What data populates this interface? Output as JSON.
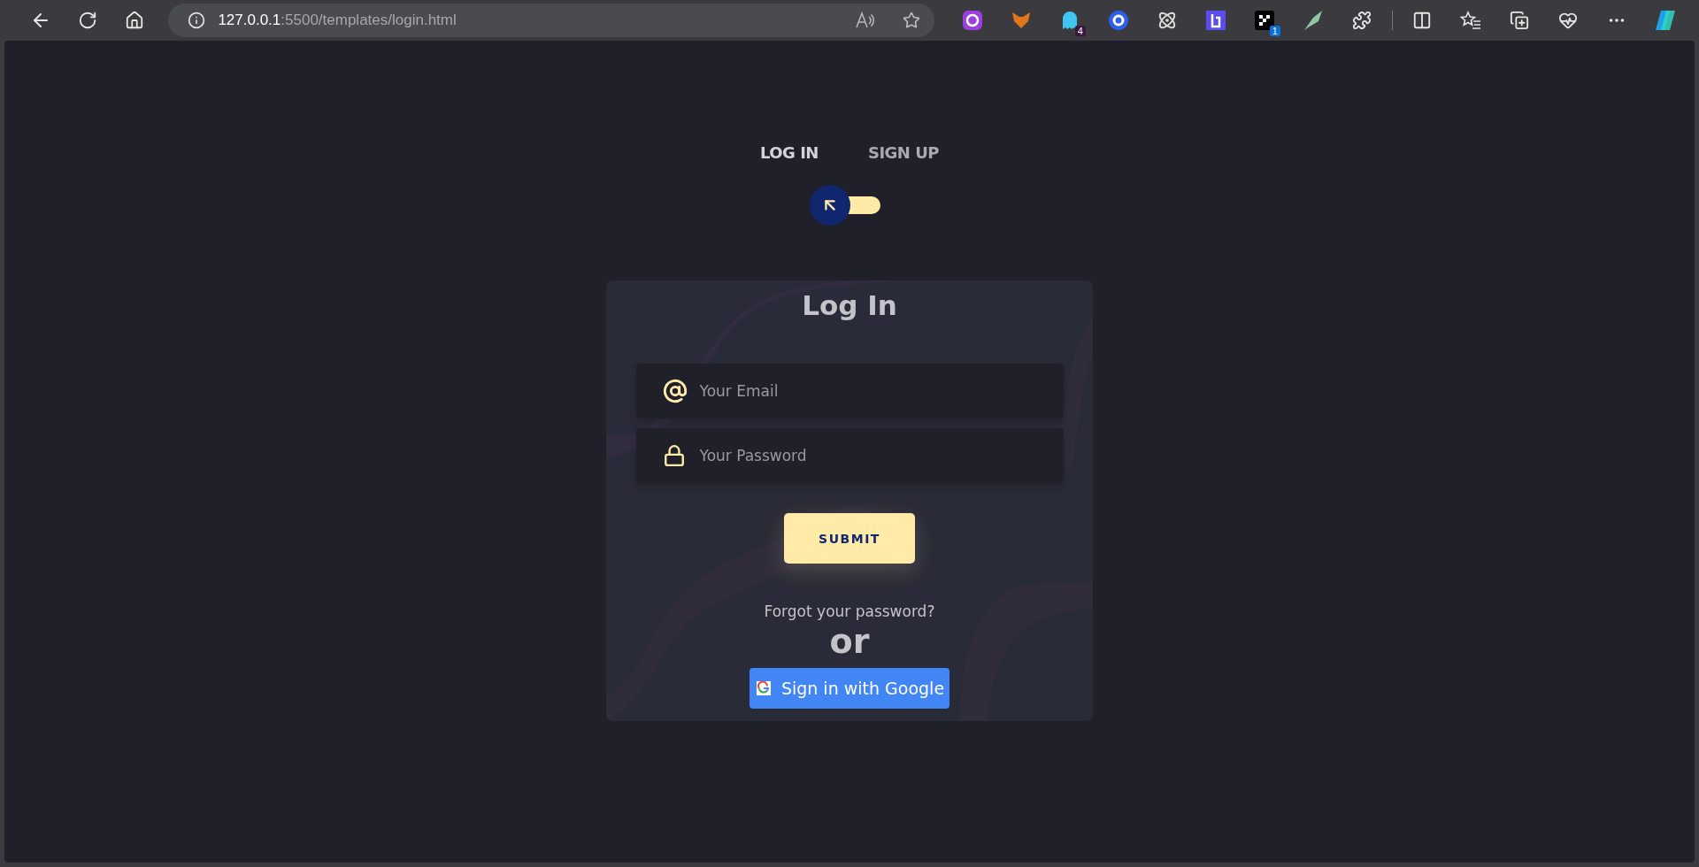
{
  "browser": {
    "url_host": "127.0.0.1",
    "url_path": ":5500/templates/login.html",
    "extensions": [
      {
        "kind": "purple"
      },
      {
        "kind": "fox"
      },
      {
        "kind": "ghost",
        "badge": "4"
      },
      {
        "kind": "ring"
      },
      {
        "kind": "atom"
      },
      {
        "kind": "bracket"
      },
      {
        "kind": "checker",
        "badge": "1"
      },
      {
        "kind": "leaf"
      }
    ]
  },
  "nav": {
    "tabs": [
      {
        "label": "LOG IN",
        "selected": true
      },
      {
        "label": "SIGN UP",
        "selected": false
      }
    ],
    "toggle": {
      "on": false
    }
  },
  "card": {
    "title": "Log In",
    "fields": [
      {
        "kind": "email",
        "placeholder": "Your Email"
      },
      {
        "kind": "password",
        "placeholder": "Your Password"
      }
    ],
    "submit": "SUBMIT",
    "forgot": "Forgot your password?",
    "divider": "or",
    "google": "Sign in with Google"
  }
}
